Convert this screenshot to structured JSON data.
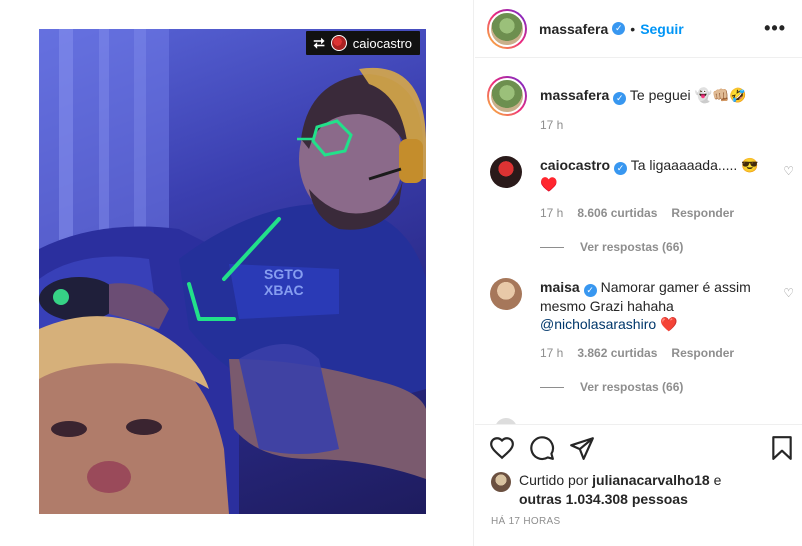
{
  "photo": {
    "repost_tag": "caiocastro",
    "repost_icon": "repost-icon"
  },
  "header": {
    "username": "massafera",
    "separator": "•",
    "follow_label": "Seguir",
    "more_icon": "more-options-icon",
    "more_text": "•••"
  },
  "caption": {
    "username": "massafera",
    "text": "Te peguei 👻👊🏼🤣",
    "time": "17 h"
  },
  "comments": [
    {
      "username": "caiocastro",
      "text": "Ta ligaaaaada..... 😎",
      "text2": "♥️",
      "time": "17 h",
      "likes": "8.606 curtidas",
      "reply_label": "Responder",
      "view_replies": "Ver respostas (66)"
    },
    {
      "username": "maisa",
      "text": "Namorar gamer é assim mesmo Grazi hahaha",
      "mention": "@nicholasarashiro",
      "emoji": "❤️",
      "time": "17 h",
      "likes": "3.862 curtidas",
      "reply_label": "Responder",
      "view_replies": "Ver respostas (66)"
    }
  ],
  "actions": {
    "like_icon": "heart-icon",
    "comment_icon": "comment-icon",
    "share_icon": "share-icon",
    "save_icon": "bookmark-icon"
  },
  "likes": {
    "prefix": "Curtido por",
    "user": "julianacarvalho18",
    "conj": "e",
    "others": "outras 1.034.308 pessoas"
  },
  "timestamp": "HÁ 17 HORAS",
  "colors": {
    "follow": "#0095f6",
    "verified": "#3897f0",
    "muted": "#8e8e8e",
    "neon": "#22e08a"
  }
}
